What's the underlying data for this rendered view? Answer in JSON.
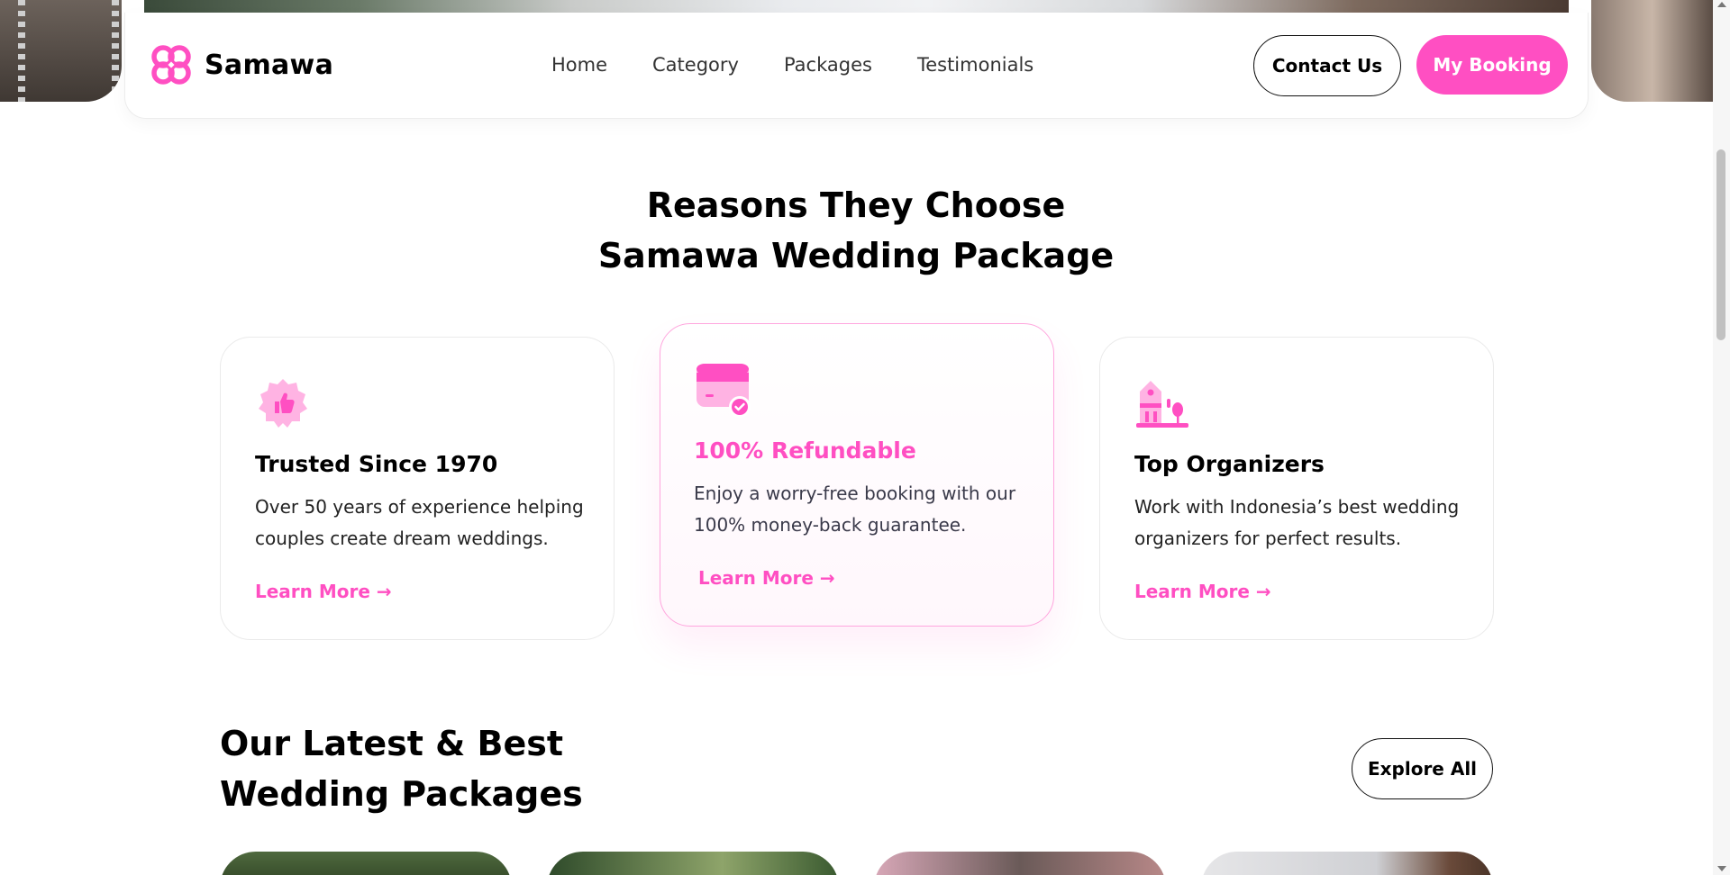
{
  "brand": {
    "name": "Samawa",
    "accent": "#ff4fc2"
  },
  "nav": {
    "links": [
      "Home",
      "Category",
      "Packages",
      "Testimonials"
    ],
    "contact_label": "Contact Us",
    "booking_label": "My Booking"
  },
  "reasons": {
    "title_line1": "Reasons They Choose",
    "title_line2": "Samawa Wedding Package",
    "cards": [
      {
        "icon": "thumbs-up-badge-icon",
        "title": "Trusted Since 1970",
        "desc": "Over 50 years of experience helping couples create dream weddings.",
        "link": "Learn More →"
      },
      {
        "icon": "card-check-icon",
        "title": "100% Refundable",
        "desc": "Enjoy a worry-free booking with our 100% money-back guarantee.",
        "link": "Learn More →"
      },
      {
        "icon": "venue-building-icon",
        "title": "Top Organizers",
        "desc": "Work with Indonesia’s best wedding organizers for perfect results.",
        "link": "Learn More →"
      }
    ]
  },
  "latest": {
    "title_line1": "Our Latest & Best",
    "title_line2": "Wedding Packages",
    "explore_label": "Explore All"
  }
}
